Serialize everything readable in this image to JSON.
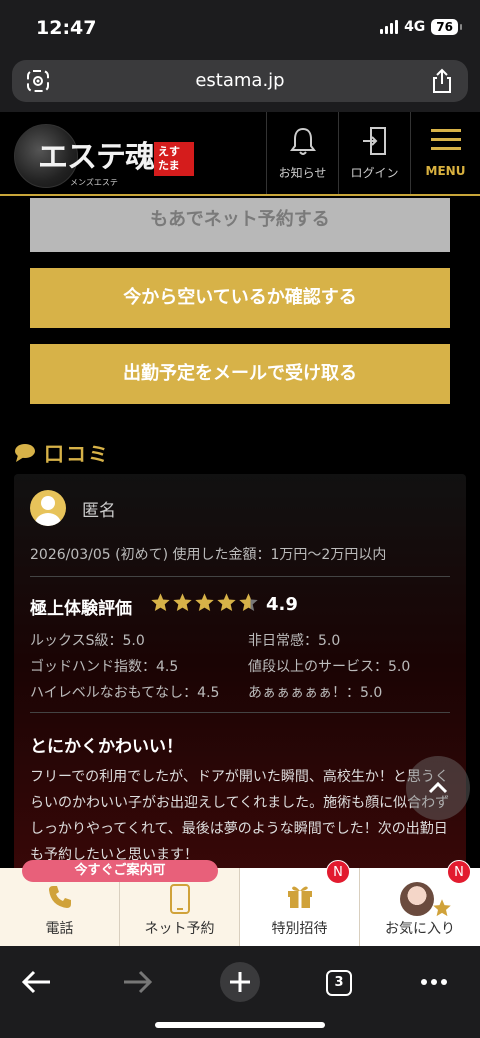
{
  "status": {
    "time": "12:47",
    "network": "4G",
    "battery": "76"
  },
  "browser": {
    "url": "estama.jp",
    "tab_count": "3"
  },
  "header": {
    "logo_text": "エステ魂",
    "logo_sub": "メンズエステ",
    "logo_tag": "えすたま",
    "nav": [
      {
        "label": "お知らせ",
        "icon": "bell-icon"
      },
      {
        "label": "ログイン",
        "icon": "login-door-icon"
      },
      {
        "label": "MENU",
        "icon": "hamburger-menu-icon"
      }
    ]
  },
  "actions": {
    "net_reserve": "もあでネット予約する",
    "check_now": "今から空いているか確認する",
    "mail_schedule": "出勤予定をメールで受け取る"
  },
  "reviews_section": {
    "title": "口コミ",
    "review": {
      "author": "匿名",
      "meta": "2026/03/05 (初めて) 使用した金額：1万円〜2万円以内",
      "rating_title": "極上体験評価",
      "rating": 4.9,
      "score_text": "4.9",
      "items": [
        "ルックスS級：5.0",
        "非日常感：5.0",
        "ゴッドハンド指数：4.5",
        "値段以上のサービス：5.0",
        "ハイレベルなおもてなし：4.5",
        "あぁぁぁぁぁ！：5.0"
      ],
      "title": "とにかくかわいい！",
      "body": "フリーでの利用でしたが、ドアが開いた瞬間、高校生か！と思うくらいのかわいい子がお出迎えしてくれました。施術も顔に似合わずしっかりやってくれて、最後は夢のような瞬間でした！次の出勤日も予約したいと思います！"
    }
  },
  "bottom_nav": {
    "pill": "今すぐご案内可",
    "items": [
      {
        "label": "電話",
        "icon": "phone-icon"
      },
      {
        "label": "ネット予約",
        "icon": "smartphone-icon"
      },
      {
        "label": "特別招待",
        "icon": "gift-icon",
        "badge": "N"
      },
      {
        "label": "お気に入り",
        "icon": "star-icon",
        "badge": "N"
      }
    ]
  },
  "colors": {
    "gold": "#d7b248",
    "accent_red": "#e21b2f",
    "pill_pink": "#e8607a"
  }
}
